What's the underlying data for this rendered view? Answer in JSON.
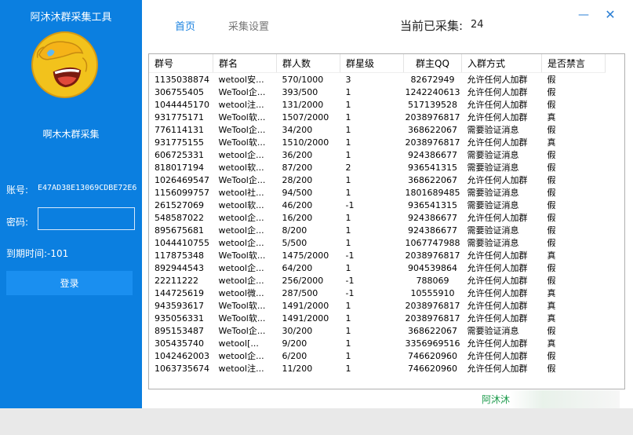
{
  "sidebar": {
    "title": "阿沐沐群采集工具",
    "name": "啊木木群采集",
    "account_label": "账号:",
    "account_value": "E47AD38E13069CDBE72E6",
    "password_label": "密码:",
    "password_value": "",
    "expiry_label": "到期时间:",
    "expiry_value": "-101",
    "login_label": "登录"
  },
  "header": {
    "tab_home": "首页",
    "tab_settings": "采集设置",
    "count_label": "当前已采集:",
    "count_value": "24",
    "minimize": "—",
    "close": "✕"
  },
  "table": {
    "columns": [
      "群号",
      "群名",
      "群人数",
      "群星级",
      "群主QQ",
      "入群方式",
      "是否禁言"
    ],
    "rows": [
      [
        "1135038874",
        "wetool安...",
        "570/1000",
        "3",
        "82672949",
        "允许任何人加群",
        "假"
      ],
      [
        "306755405",
        "WeTool企...",
        "393/500",
        "1",
        "1242240613",
        "允许任何人加群",
        "假"
      ],
      [
        "1044445170",
        "wetool注...",
        "131/2000",
        "1",
        "517139528",
        "允许任何人加群",
        "假"
      ],
      [
        "931775171",
        "WeTool软...",
        "1507/2000",
        "1",
        "2038976817",
        "允许任何人加群",
        "真"
      ],
      [
        "776114131",
        "WeTool企...",
        "34/200",
        "1",
        "368622067",
        "需要验证消息",
        "假"
      ],
      [
        "931775155",
        "WeTool软...",
        "1510/2000",
        "1",
        "2038976817",
        "允许任何人加群",
        "真"
      ],
      [
        "606725331",
        "wetool企...",
        "36/200",
        "1",
        "924386677",
        "需要验证消息",
        "假"
      ],
      [
        "818017194",
        "wetool软...",
        "87/200",
        "2",
        "936541315",
        "需要验证消息",
        "假"
      ],
      [
        "1026469547",
        "WeTool企...",
        "28/200",
        "1",
        "368622067",
        "允许任何人加群",
        "假"
      ],
      [
        "1156099757",
        "wetool社...",
        "94/500",
        "1",
        "1801689485",
        "需要验证消息",
        "假"
      ],
      [
        "261527069",
        "wetool软...",
        "46/200",
        "-1",
        "936541315",
        "需要验证消息",
        "假"
      ],
      [
        "548587022",
        "wetool企...",
        "16/200",
        "1",
        "924386677",
        "允许任何人加群",
        "假"
      ],
      [
        "895675681",
        "wetool企...",
        "8/200",
        "1",
        "924386677",
        "需要验证消息",
        "假"
      ],
      [
        "1044410755",
        "wetool企...",
        "5/500",
        "1",
        "1067747988",
        "需要验证消息",
        "假"
      ],
      [
        "117875348",
        "WeTool软...",
        "1475/2000",
        "-1",
        "2038976817",
        "允许任何人加群",
        "真"
      ],
      [
        "892944543",
        "wetool企...",
        "64/200",
        "1",
        "904539864",
        "允许任何人加群",
        "假"
      ],
      [
        "22211222",
        "wetool企...",
        "256/2000",
        "-1",
        "788069",
        "允许任何人加群",
        "假"
      ],
      [
        "144725619",
        "wetool微...",
        "287/500",
        "-1",
        "10555910",
        "允许任何人加群",
        "真"
      ],
      [
        "943593617",
        "WeTool软...",
        "1491/2000",
        "1",
        "2038976817",
        "允许任何人加群",
        "真"
      ],
      [
        "935056331",
        "WeTool软...",
        "1491/2000",
        "1",
        "2038976817",
        "允许任何人加群",
        "真"
      ],
      [
        "895153487",
        "WeTool企...",
        "30/200",
        "1",
        "368622067",
        "需要验证消息",
        "假"
      ],
      [
        "305435740",
        "wetool[...",
        "9/200",
        "1",
        "3356969516",
        "允许任何人加群",
        "真"
      ],
      [
        "1042462003",
        "wetool企...",
        "6/200",
        "1",
        "746620960",
        "允许任何人加群",
        "假"
      ],
      [
        "1063735674",
        "wetool注...",
        "11/200",
        "1",
        "746620960",
        "允许任何人加群",
        "假"
      ]
    ]
  },
  "footer": {
    "text": "阿沐沐"
  }
}
